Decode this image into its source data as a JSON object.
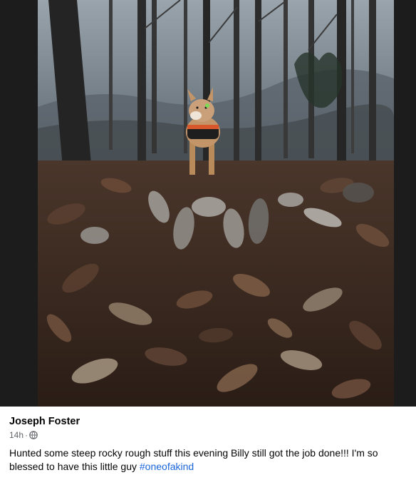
{
  "post": {
    "author": "Joseph Foster",
    "timestamp": "14h",
    "separator": "·",
    "privacy_icon": "globe-icon",
    "caption_text": "Hunted some steep rocky rough stuff this evening Billy still got the job done!!! I'm so blessed to have this little guy ",
    "hashtag": "#oneofakind"
  },
  "photo": {
    "icons": [
      "tree-icon",
      "dog-icon",
      "leaf-icon"
    ]
  },
  "colors": {
    "hashtag_blue": "#1a66d9",
    "secondary_text": "#65676b",
    "primary_text": "#050505"
  }
}
